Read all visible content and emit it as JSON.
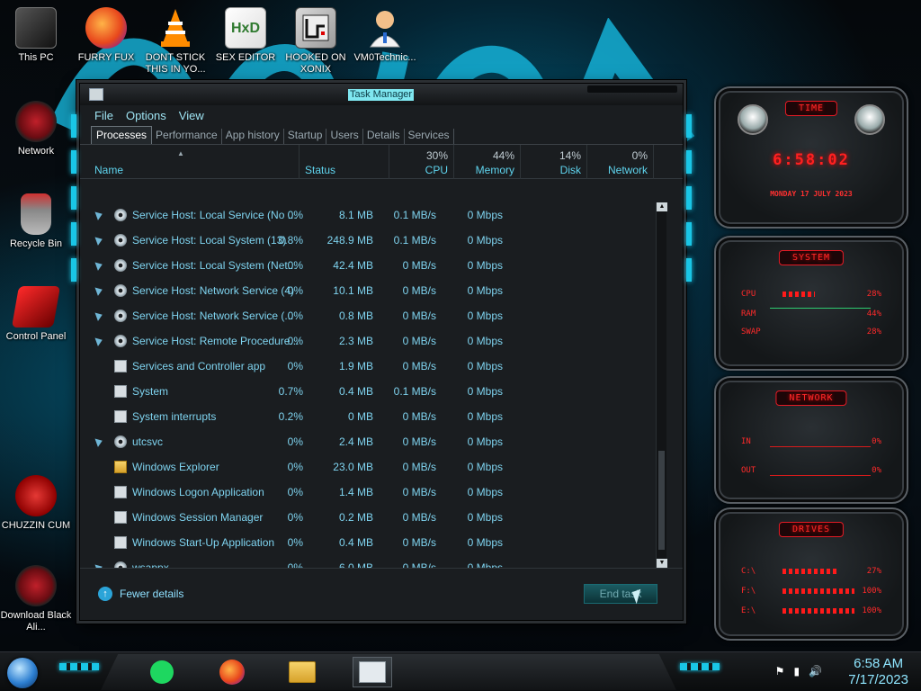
{
  "desktop_icons": [
    {
      "label": "This PC",
      "icon": "computer-icon"
    },
    {
      "label": "FURRY FUX",
      "icon": "firefox-icon"
    },
    {
      "label": "DONT STICK THIS IN YO...",
      "icon": "vlc-cone-icon"
    },
    {
      "label": "SEX EDITOR",
      "icon": "hxd-hex-editor-icon"
    },
    {
      "label": "HOOKED ON XONIX",
      "icon": "game-icon"
    },
    {
      "label": "VM0Technic...",
      "icon": "doctor-avatar-icon"
    },
    {
      "label": "Network",
      "icon": "network-orb-icon"
    },
    {
      "label": "Recycle Bin",
      "icon": "recycle-bin-icon"
    },
    {
      "label": "Control Panel",
      "icon": "control-panel-icon"
    },
    {
      "label": "CHUZZIN CUM",
      "icon": "red-fuzzy-icon"
    },
    {
      "label": "Download Black Ali...",
      "icon": "alienware-orb-icon"
    }
  ],
  "task_manager": {
    "title": "Task Manager",
    "menu": [
      "File",
      "Options",
      "View"
    ],
    "tabs": [
      "Processes",
      "Performance",
      "App history",
      "Startup",
      "Users",
      "Details",
      "Services"
    ],
    "active_tab": "Processes",
    "columns": {
      "name": "Name",
      "status": "Status",
      "cpu": {
        "label": "CPU",
        "pct": "30%"
      },
      "memory": {
        "label": "Memory",
        "pct": "44%"
      },
      "disk": {
        "label": "Disk",
        "pct": "14%"
      },
      "network": {
        "label": "Network",
        "pct": "0%"
      }
    },
    "rows": [
      {
        "name": "Service Host: Local Service (No ...",
        "cpu": "0%",
        "memory": "8.1 MB",
        "disk": "0.1 MB/s",
        "network": "0 Mbps",
        "expandable": true,
        "icon": "gear"
      },
      {
        "name": "Service Host: Local System (13)",
        "cpu": "0.8%",
        "memory": "248.9 MB",
        "disk": "0.1 MB/s",
        "network": "0 Mbps",
        "expandable": true,
        "icon": "gear"
      },
      {
        "name": "Service Host: Local System (Net...",
        "cpu": "0%",
        "memory": "42.4 MB",
        "disk": "0 MB/s",
        "network": "0 Mbps",
        "expandable": true,
        "icon": "gear"
      },
      {
        "name": "Service Host: Network Service (4)",
        "cpu": "0%",
        "memory": "10.1 MB",
        "disk": "0 MB/s",
        "network": "0 Mbps",
        "expandable": true,
        "icon": "gear"
      },
      {
        "name": "Service Host: Network Service (...",
        "cpu": "0%",
        "memory": "0.8 MB",
        "disk": "0 MB/s",
        "network": "0 Mbps",
        "expandable": true,
        "icon": "gear"
      },
      {
        "name": "Service Host: Remote Procedure...",
        "cpu": "0%",
        "memory": "2.3 MB",
        "disk": "0 MB/s",
        "network": "0 Mbps",
        "expandable": true,
        "icon": "gear"
      },
      {
        "name": "Services and Controller app",
        "cpu": "0%",
        "memory": "1.9 MB",
        "disk": "0 MB/s",
        "network": "0 Mbps",
        "expandable": false,
        "icon": "window"
      },
      {
        "name": "System",
        "cpu": "0.7%",
        "memory": "0.4 MB",
        "disk": "0.1 MB/s",
        "network": "0 Mbps",
        "expandable": false,
        "icon": "window"
      },
      {
        "name": "System interrupts",
        "cpu": "0.2%",
        "memory": "0 MB",
        "disk": "0 MB/s",
        "network": "0 Mbps",
        "expandable": false,
        "icon": "window"
      },
      {
        "name": "utcsvc",
        "cpu": "0%",
        "memory": "2.4 MB",
        "disk": "0 MB/s",
        "network": "0 Mbps",
        "expandable": true,
        "icon": "gear"
      },
      {
        "name": "Windows Explorer",
        "cpu": "0%",
        "memory": "23.0 MB",
        "disk": "0 MB/s",
        "network": "0 Mbps",
        "expandable": false,
        "icon": "folder"
      },
      {
        "name": "Windows Logon Application",
        "cpu": "0%",
        "memory": "1.4 MB",
        "disk": "0 MB/s",
        "network": "0 Mbps",
        "expandable": false,
        "icon": "window"
      },
      {
        "name": "Windows Session Manager",
        "cpu": "0%",
        "memory": "0.2 MB",
        "disk": "0 MB/s",
        "network": "0 Mbps",
        "expandable": false,
        "icon": "window"
      },
      {
        "name": "Windows Start-Up Application",
        "cpu": "0%",
        "memory": "0.4 MB",
        "disk": "0 MB/s",
        "network": "0 Mbps",
        "expandable": false,
        "icon": "window"
      },
      {
        "name": "wsappx",
        "cpu": "0%",
        "memory": "6.0 MB",
        "disk": "0 MB/s",
        "network": "0 Mbps",
        "expandable": true,
        "icon": "gear"
      }
    ],
    "footer": {
      "fewer_details": "Fewer details",
      "end_task": "End task"
    }
  },
  "gadgets": {
    "time": {
      "header": "TIME",
      "clock": "6:58:02",
      "date": "MONDAY 17 JULY 2023"
    },
    "system": {
      "header": "SYSTEM",
      "items": [
        {
          "k": "CPU",
          "v": "28%"
        },
        {
          "k": "RAM",
          "v": "44%"
        },
        {
          "k": "SWAP",
          "v": "28%"
        }
      ]
    },
    "network": {
      "header": "NETWORK",
      "items": [
        {
          "k": "IN",
          "v": "0%"
        },
        {
          "k": "OUT",
          "v": "0%"
        }
      ]
    },
    "drives": {
      "header": "DRIVES",
      "items": [
        {
          "k": "C:\\",
          "v": "27%"
        },
        {
          "k": "F:\\",
          "v": "100%"
        },
        {
          "k": "E:\\",
          "v": "100%"
        }
      ]
    }
  },
  "taskbar": {
    "apps": [
      "spotify-icon",
      "firefox-icon",
      "file-explorer-icon",
      "task-manager-icon"
    ],
    "tray_icons": [
      "flag-icon",
      "network-icon",
      "volume-icon"
    ],
    "clock": {
      "time": "6:58 AM",
      "date": "7/17/2023"
    }
  },
  "colors": {
    "accent_cyan": "#19c6e6",
    "gadget_red": "#ff2020",
    "text_cyan": "#7fd4f0"
  }
}
